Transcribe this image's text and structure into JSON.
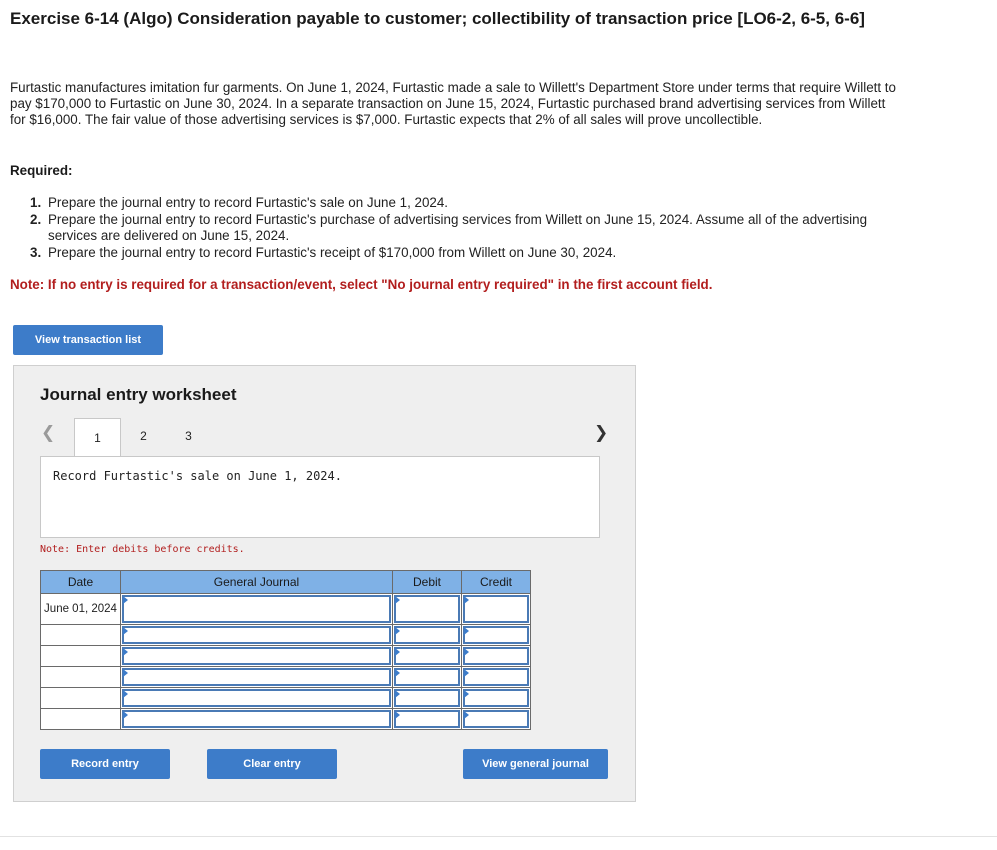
{
  "title": "Exercise 6-14 (Algo) Consideration payable to customer; collectibility of transaction price [LO6-2, 6-5, 6-6]",
  "intro": "Furtastic manufactures imitation fur garments. On June 1, 2024, Furtastic made a sale to Willett's Department Store under terms that require Willett to pay $170,000 to Furtastic on June 30, 2024. In a separate transaction on June 15, 2024, Furtastic purchased brand advertising services from Willett for $16,000. The fair value of those advertising services is $7,000. Furtastic expects that 2% of all sales will prove uncollectible.",
  "required_label": "Required:",
  "requirements": [
    {
      "num": "1.",
      "text": "Prepare the journal entry to record Furtastic's sale on June 1, 2024."
    },
    {
      "num": "2.",
      "text": "Prepare the journal entry to record Furtastic's purchase of advertising services from Willett on June 15, 2024. Assume all of the advertising services are delivered on June 15, 2024."
    },
    {
      "num": "3.",
      "text": "Prepare the journal entry to record Furtastic's receipt of $170,000 from Willett on June 30, 2024."
    }
  ],
  "note": "Note: If no entry is required for a transaction/event, select \"No journal entry required\" in the first account field.",
  "view_transaction_list": "View transaction list",
  "worksheet": {
    "title": "Journal entry worksheet",
    "tabs": [
      "1",
      "2",
      "3"
    ],
    "active_tab": "1",
    "prompt": "Record Furtastic's sale on June 1, 2024.",
    "note": "Note: Enter debits before credits.",
    "columns": {
      "date": "Date",
      "journal": "General Journal",
      "debit": "Debit",
      "credit": "Credit"
    },
    "first_date": "June 01, 2024",
    "record_entry": "Record entry",
    "clear_entry": "Clear entry",
    "view_general_journal": "View general journal"
  },
  "colors": {
    "accent": "#3d7cc9",
    "header": "#7fb1e6",
    "note_red": "#b21e1e"
  },
  "icons": {
    "prev": "chevron-left-icon",
    "next": "chevron-right-icon"
  }
}
